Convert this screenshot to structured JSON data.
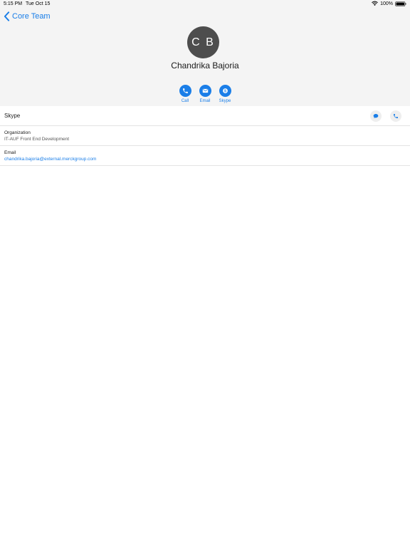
{
  "status_bar": {
    "time": "5:15 PM",
    "date": "Tue Oct 15",
    "battery": "100%",
    "icons": [
      "wifi-icon",
      "battery-icon"
    ]
  },
  "nav": {
    "back_label": "Core Team",
    "back_icon": "chevron-left-icon"
  },
  "contact": {
    "initials": "C B",
    "name": "Chandrika Bajoria"
  },
  "actions": [
    {
      "label": "Call",
      "icon": "phone-icon"
    },
    {
      "label": "Email",
      "icon": "envelope-icon"
    },
    {
      "label": "Skype",
      "icon": "skype-icon"
    }
  ],
  "skype": {
    "title": "Skype",
    "buttons": [
      {
        "icon": "chat-bubble-icon"
      },
      {
        "icon": "phone-icon"
      }
    ]
  },
  "details": [
    {
      "label": "Organization",
      "value": "IT-AUF Front End Development"
    },
    {
      "label": "Email",
      "value": "chandrika.bajoria@external.merckgroup.com"
    }
  ],
  "colors": {
    "accent": "#1a7ee8",
    "header_bg": "#f4f4f4",
    "avatar_bg": "#4d4d4d",
    "divider": "#e3e3e3"
  }
}
